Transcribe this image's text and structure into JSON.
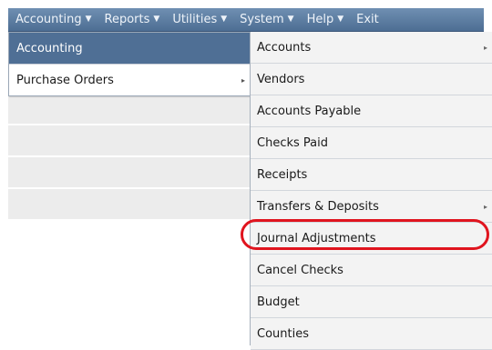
{
  "menubar": {
    "items": [
      {
        "label": "Accounting",
        "caret": "▼"
      },
      {
        "label": "Reports",
        "caret": "▼"
      },
      {
        "label": "Utilities",
        "caret": "▼"
      },
      {
        "label": "System",
        "caret": "▼"
      },
      {
        "label": "Help",
        "caret": "▼"
      },
      {
        "label": "Exit",
        "caret": ""
      }
    ]
  },
  "menu1": {
    "items": [
      {
        "label": "Accounting",
        "has_submenu": false
      },
      {
        "label": "Purchase Orders",
        "has_submenu": true
      }
    ]
  },
  "submenu": {
    "items": [
      {
        "label": "Accounts",
        "has_submenu": true
      },
      {
        "label": "Vendors",
        "has_submenu": false
      },
      {
        "label": "Accounts Payable",
        "has_submenu": false
      },
      {
        "label": "Checks Paid",
        "has_submenu": false
      },
      {
        "label": "Receipts",
        "has_submenu": false
      },
      {
        "label": "Transfers & Deposits",
        "has_submenu": true
      },
      {
        "label": "Journal Adjustments",
        "has_submenu": false
      },
      {
        "label": "Cancel Checks",
        "has_submenu": false
      },
      {
        "label": "Budget",
        "has_submenu": false
      },
      {
        "label": "Counties",
        "has_submenu": false
      }
    ]
  },
  "icons": {
    "submenu_arrow": "▸",
    "caret": "▼"
  },
  "colors": {
    "menubar": "#5c7ca3",
    "active_item": "#4f6f95",
    "highlight": "#e0141e"
  }
}
